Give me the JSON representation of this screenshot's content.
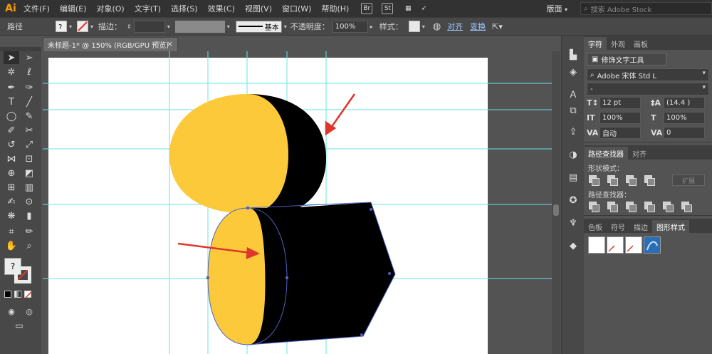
{
  "app": {
    "logo": "Ai"
  },
  "menu": [
    "文件(F)",
    "编辑(E)",
    "对象(O)",
    "文字(T)",
    "选择(S)",
    "效果(C)",
    "视图(V)",
    "窗口(W)",
    "帮助(H)"
  ],
  "menu_icons": {
    "br": "Br",
    "st": "St"
  },
  "workspace": {
    "label": "版面",
    "search_placeholder": "搜索 Adobe Stock"
  },
  "controlbar": {
    "selection_label": "路径",
    "stroke_label": "描边：",
    "stroke_style": "基本",
    "opacity_label": "不透明度：",
    "opacity_value": "100%",
    "style_label": "样式：",
    "align_link": "对齐",
    "transform_link": "变换"
  },
  "document": {
    "tab_title": "未标题-1* @ 150% (RGB/GPU 预览)"
  },
  "colors": {
    "yellow": "#FCC93B",
    "black": "#000000",
    "guide": "#67E4E4",
    "arrow": "#E0352B",
    "path": "#4E5FC0"
  },
  "panels": {
    "top_tabs": [
      "字符",
      "外观",
      "画板"
    ],
    "touch_type_button": "修饰文字工具",
    "font_family": "Adobe 宋体 Std L",
    "font_style": "-",
    "font_size": "12 pt",
    "leading": "(14.4 )",
    "vertical_scale": "100%",
    "horizontal_scale": "100%",
    "tracking_auto": "自动",
    "kerning": "0",
    "pathfinder_tabs": [
      "路径查找器",
      "对齐"
    ],
    "shape_modes_label": "形状模式：",
    "expand_button": "扩展",
    "pathfinders_label": "路径查找器：",
    "bottom_tabs": [
      "色板",
      "符号",
      "描边",
      "图形样式"
    ]
  }
}
